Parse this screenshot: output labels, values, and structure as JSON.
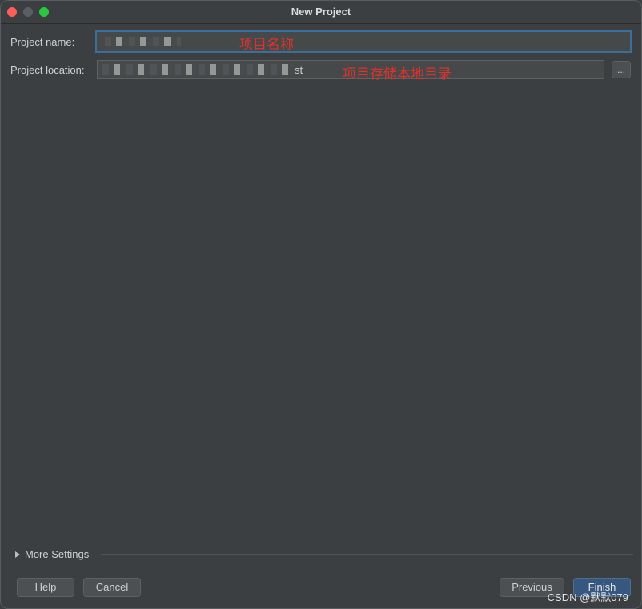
{
  "window": {
    "title": "New Project"
  },
  "form": {
    "name_label": "Project name:",
    "name_value": "",
    "name_annotation": "项目名称",
    "location_label": "Project location:",
    "location_value_suffix": "st",
    "location_annotation": "项目存储本地目录",
    "browse_label": "..."
  },
  "footer": {
    "more_settings": "More Settings",
    "help": "Help",
    "cancel": "Cancel",
    "previous": "Previous",
    "finish": "Finish"
  },
  "watermark": "CSDN @默默079",
  "colors": {
    "background": "#3c3f41",
    "field": "#45494a",
    "focus_border": "#3d6e99",
    "annotation": "#e0322b",
    "primary_button": "#365880"
  }
}
